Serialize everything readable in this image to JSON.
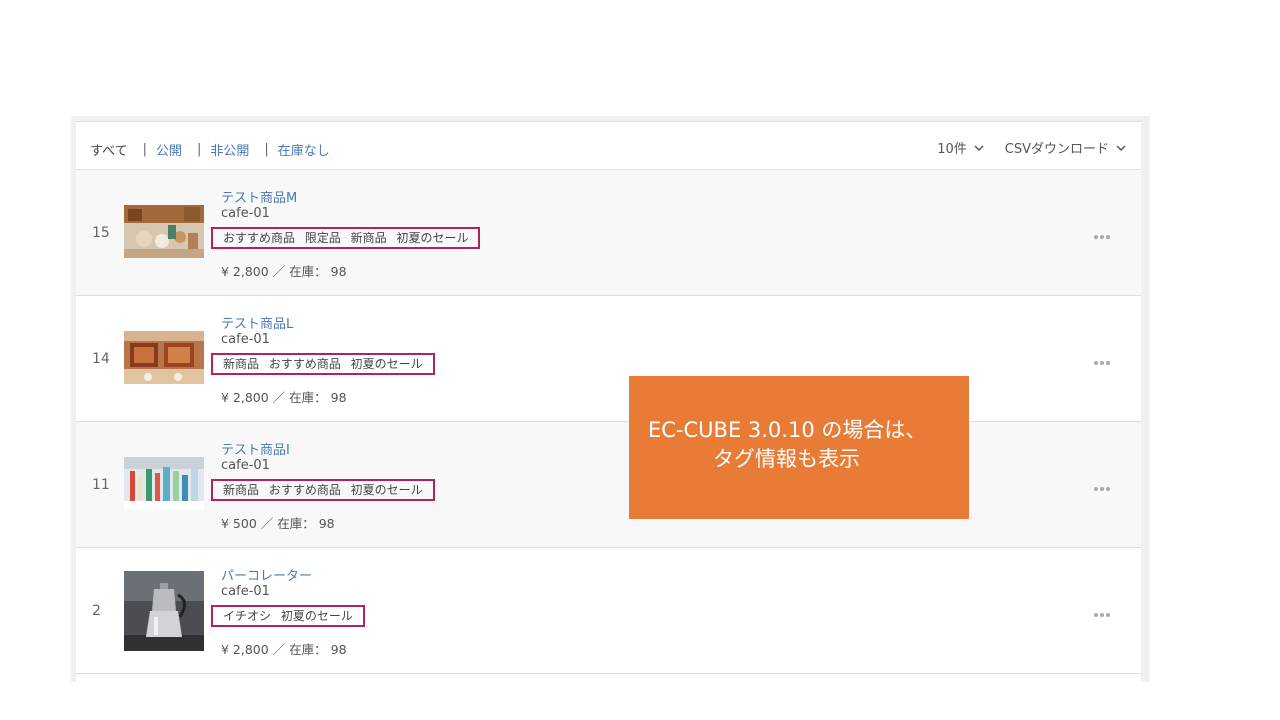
{
  "filters": {
    "all": "すべて",
    "public": "公開",
    "private": "非公開",
    "out_of_stock": "在庫なし",
    "separator": "|"
  },
  "controls": {
    "per_page": "10件",
    "csv": "CSVダウンロード"
  },
  "products": [
    {
      "id": "15",
      "name": "テスト商品M",
      "code": "cafe-01",
      "tags": "おすすめ商品 限定品 新商品 初夏のセール",
      "price": "¥ 2,800 ／ 在庫： 98"
    },
    {
      "id": "14",
      "name": "テスト商品L",
      "code": "cafe-01",
      "tags": "新商品 おすすめ商品 初夏のセール",
      "price": "¥ 2,800 ／ 在庫： 98"
    },
    {
      "id": "11",
      "name": "テスト商品I",
      "code": "cafe-01",
      "tags": "新商品 おすすめ商品 初夏のセール",
      "price": "¥ 500 ／ 在庫： 98"
    },
    {
      "id": "2",
      "name": "パーコレーター",
      "code": "cafe-01",
      "tags": "イチオシ 初夏のセール",
      "price": "¥ 2,800 ／ 在庫： 98"
    }
  ],
  "callout": {
    "line1": "EC-CUBE 3.0.10 の場合は、",
    "line2": "タグ情報も表示"
  },
  "colors": {
    "link": "#4a78b5",
    "tag_border": "#b5215e",
    "callout_bg": "#e87c37"
  }
}
